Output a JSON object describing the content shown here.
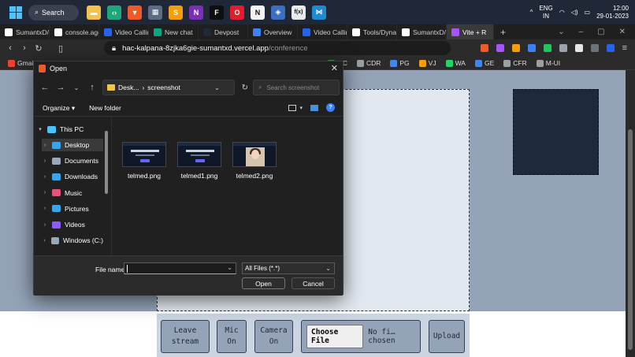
{
  "taskbar": {
    "search_label": "Search",
    "pinned_apps": [
      {
        "name": "file-explorer-icon",
        "color": "#f2c14e",
        "glyph": "▬"
      },
      {
        "name": "bluej-icon",
        "color": "#1fa67a",
        "glyph": "‹›"
      },
      {
        "name": "brave-icon",
        "color": "#ef5a28",
        "glyph": "▼"
      },
      {
        "name": "calculator-icon",
        "color": "#5c6c84",
        "glyph": "▦"
      },
      {
        "name": "sublime-icon",
        "color": "#f59e0b",
        "glyph": "S"
      },
      {
        "name": "onenote-icon",
        "color": "#7b2fb5",
        "glyph": "N"
      },
      {
        "name": "figma-icon",
        "color": "#0f0f0f",
        "glyph": "F"
      },
      {
        "name": "opera-icon",
        "color": "#e11d2e",
        "glyph": "O"
      },
      {
        "name": "notion-icon",
        "color": "#f3f3f3",
        "glyph": "N"
      },
      {
        "name": "virtualbox-icon",
        "color": "#3b6fc0",
        "glyph": "◈"
      },
      {
        "name": "fx-app-icon",
        "color": "#eaeaea",
        "glyph": "f(x)"
      },
      {
        "name": "vscode-icon",
        "color": "#1f8ad2",
        "glyph": "⋈"
      }
    ],
    "lang_line1": "ENG",
    "lang_line2": "IN",
    "time": "12:00",
    "date": "29-01-2023"
  },
  "browser": {
    "tabs": [
      {
        "label": "SumantxD/t",
        "color": "#ffffff"
      },
      {
        "label": "console.ago",
        "color": "#ffffff"
      },
      {
        "label": "Video Calling",
        "color": "#2563eb"
      },
      {
        "label": "New chat",
        "color": "#10a37f"
      },
      {
        "label": "Devpost",
        "color": "#1f2937"
      },
      {
        "label": "Overview",
        "color": "#3b82f6"
      },
      {
        "label": "Video Calling",
        "color": "#2563eb"
      },
      {
        "label": "Tools/Dyna",
        "color": "#ffffff"
      },
      {
        "label": "SumantxD/l",
        "color": "#ffffff"
      },
      {
        "label": "Vite + R",
        "color": "#a855f7"
      }
    ],
    "new_tab": "+",
    "url_host": "hac-kalpana-8zjka6gie-sumantxd.vercel.app",
    "url_path": "/conference",
    "bookmarks": [
      {
        "label": "Gmail",
        "color": "#ea4335"
      },
      {
        "label": "GC",
        "color": "#34a853"
      },
      {
        "label": "CDR",
        "color": "#9aa0a6"
      },
      {
        "label": "PG",
        "color": "#4285f4"
      },
      {
        "label": "VJ",
        "color": "#f59e0b"
      },
      {
        "label": "WA",
        "color": "#25d366"
      },
      {
        "label": "GE",
        "color": "#4285f4"
      },
      {
        "label": "CFR",
        "color": "#9aa0a6"
      },
      {
        "label": "M-UI",
        "color": "#9aa0a6"
      }
    ]
  },
  "dialog": {
    "title": "Open",
    "path_parts": [
      "Desk...",
      "screenshot"
    ],
    "search_placeholder": "Search screenshot",
    "organize_label": "Organize",
    "new_folder_label": "New folder",
    "sidebar": [
      {
        "label": "This PC",
        "color": "#4cc2ff",
        "expanded": true
      },
      {
        "label": "Desktop",
        "color": "#3ba3e8",
        "selected": true
      },
      {
        "label": "Documents",
        "color": "#9aa7b8"
      },
      {
        "label": "Downloads",
        "color": "#3ba3e8"
      },
      {
        "label": "Music",
        "color": "#e0567a"
      },
      {
        "label": "Pictures",
        "color": "#3ba3e8"
      },
      {
        "label": "Videos",
        "color": "#8b5cf6"
      },
      {
        "label": "Windows (C:)",
        "color": "#9aa7b8"
      }
    ],
    "files": [
      {
        "name": "telmed.png",
        "kind": "page"
      },
      {
        "name": "telmed1.png",
        "kind": "page"
      },
      {
        "name": "telmed2.png",
        "kind": "photo"
      }
    ],
    "file_name_label": "File name:",
    "file_name_value": "",
    "file_type": "All Files (*.*)",
    "open_label": "Open",
    "cancel_label": "Cancel"
  },
  "conference": {
    "leave_label_1": "Leave",
    "leave_label_2": "stream",
    "mic_label_1": "Mic",
    "mic_label_2": "On",
    "camera_label_1": "Camera",
    "camera_label_2": "On",
    "choose_file_label": "Choose File",
    "file_status": "No fi…chosen",
    "upload_label": "Upload"
  }
}
